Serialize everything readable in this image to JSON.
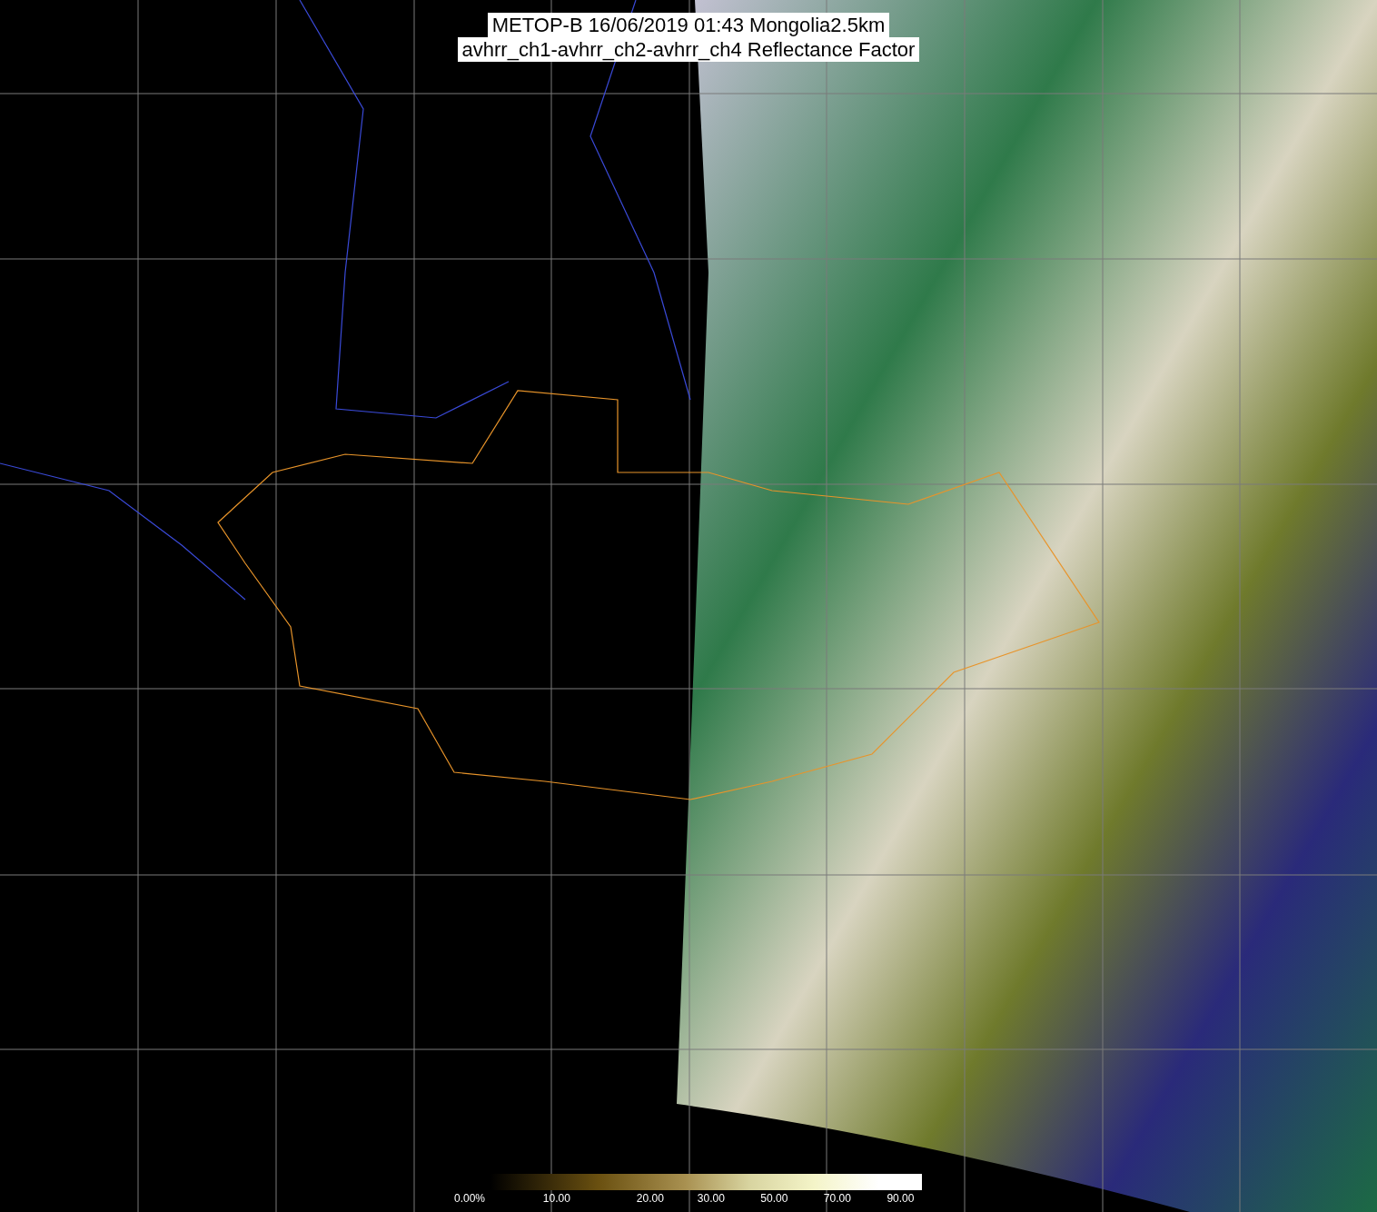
{
  "title": {
    "lines": [
      "METOP-B 16/06/2019 01:43 Mongolia2.5km",
      "avhrr_ch1-avhrr_ch2-avhrr_ch4 Reflectance Factor"
    ]
  },
  "colorbar": {
    "labels": [
      "0.00%",
      "10.00",
      "20.00",
      "30.00",
      "50.00",
      "70.00",
      "90.00"
    ]
  }
}
